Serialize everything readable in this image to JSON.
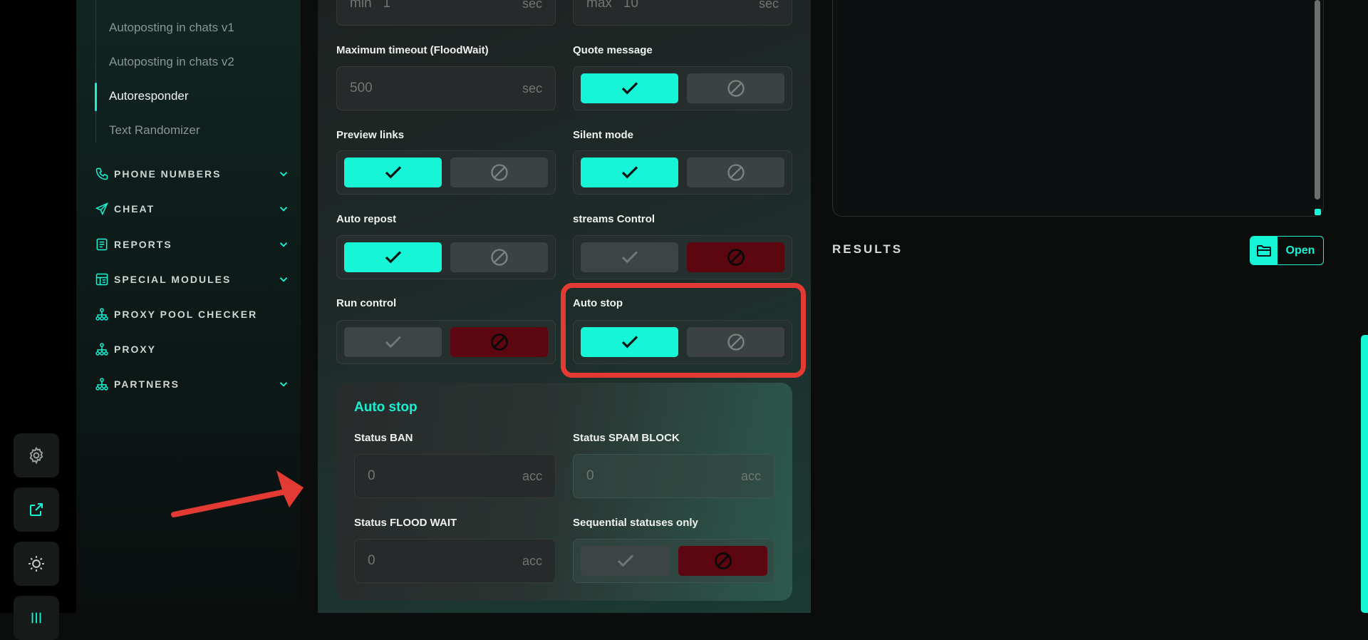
{
  "sidebar": {
    "sub_items": [
      {
        "label": "Autoposting in chats v1"
      },
      {
        "label": "Autoposting in chats v2"
      },
      {
        "label": "Autoresponder"
      },
      {
        "label": "Text Randomizer"
      }
    ],
    "nav": [
      {
        "label": "PHONE NUMBERS",
        "icon": "phone-icon"
      },
      {
        "label": "CHEAT",
        "icon": "send-icon"
      },
      {
        "label": "REPORTS",
        "icon": "report-icon"
      },
      {
        "label": "SPECIAL MODULES",
        "icon": "modules-icon"
      },
      {
        "label": "PROXY POOL CHECKER",
        "icon": "network-icon"
      },
      {
        "label": "PROXY",
        "icon": "network-icon"
      },
      {
        "label": "PARTNERS",
        "icon": "network-icon"
      }
    ]
  },
  "settings": {
    "delay_min": {
      "prefix": "min",
      "value": "1",
      "unit": "sec"
    },
    "delay_max": {
      "prefix": "max",
      "value": "10",
      "unit": "sec"
    },
    "max_timeout": {
      "label": "Maximum timeout (FloodWait)",
      "placeholder": "500",
      "unit": "sec"
    },
    "quote_message": {
      "label": "Quote message"
    },
    "preview_links": {
      "label": "Preview links"
    },
    "silent_mode": {
      "label": "Silent mode"
    },
    "auto_repost": {
      "label": "Auto repost"
    },
    "streams_control": {
      "label": "streams Control"
    },
    "run_control": {
      "label": "Run control"
    },
    "auto_stop": {
      "label": "Auto stop"
    }
  },
  "autostop_panel": {
    "title": "Auto stop",
    "status_ban": {
      "label": "Status BAN",
      "placeholder": "0",
      "unit": "acc"
    },
    "status_spam": {
      "label": "Status SPAM BLOCK",
      "placeholder": "0",
      "unit": "acc"
    },
    "status_flood": {
      "label": "Status FLOOD WAIT",
      "placeholder": "0",
      "unit": "acc"
    },
    "sequential": {
      "label": "Sequential statuses only"
    }
  },
  "results": {
    "title": "RESULTS",
    "open_label": "Open"
  },
  "colors": {
    "accent": "#16f5d6",
    "danger": "#5c0710",
    "highlight": "#e33b34"
  }
}
